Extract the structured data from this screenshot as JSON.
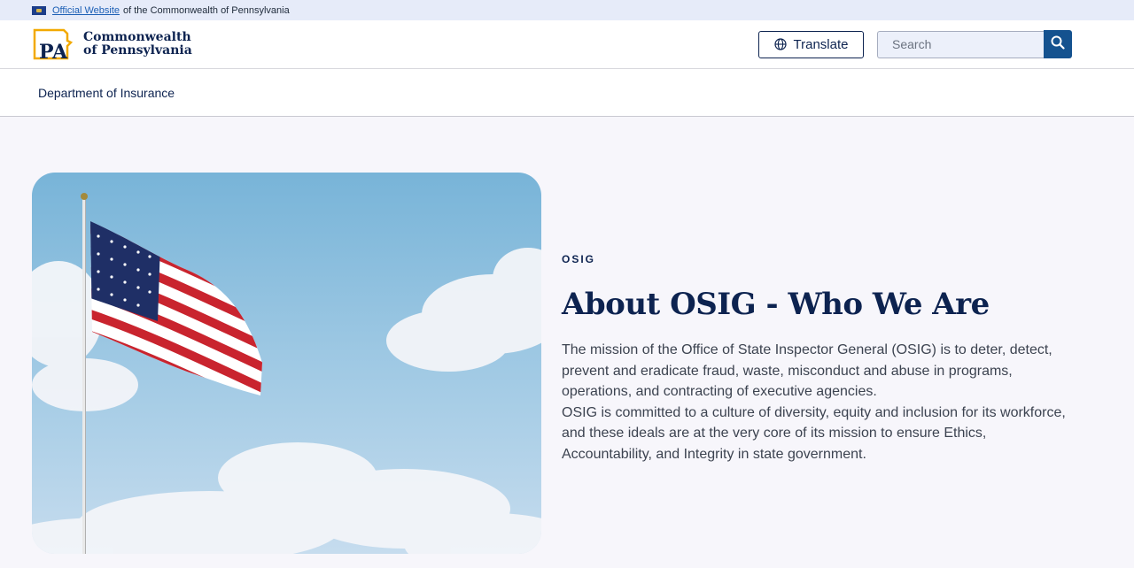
{
  "topbar": {
    "official_link": "Official Website",
    "rest": "of the Commonwealth of Pennsylvania"
  },
  "header": {
    "logo_line1": "Commonwealth",
    "logo_line2": "of Pennsylvania",
    "logo_mark_text": "PA",
    "translate_label": "Translate",
    "search_placeholder": "Search"
  },
  "subnav": {
    "department": "Department of Insurance"
  },
  "hero": {
    "eyebrow": "OSIG",
    "title": "About OSIG - Who We Are",
    "paragraph1": "The mission of the Office of State Inspector General (OSIG) is to deter, detect, prevent and eradicate fraud, waste, misconduct and abuse in programs, operations, and contracting of executive agencies.",
    "paragraph2": "OSIG is committed to a culture of diversity, equity and inclusion for its workforce, and these ideals are at the very core of its mission to ensure Ethics, Accountability, and Integrity in state government."
  },
  "colors": {
    "navy": "#0d2350",
    "accent_blue": "#14528f",
    "logo_gold": "#f2a900",
    "topbar_bg": "#e6ebf9"
  }
}
